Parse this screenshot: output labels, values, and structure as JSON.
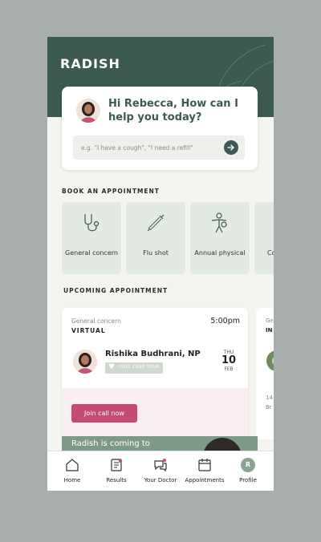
{
  "app": {
    "logo": "RADISH"
  },
  "greeting": {
    "text": "Hi Rebecca, How can I help you today?",
    "search_placeholder": "e.g. \"I have a cough\", \"I need a refill\""
  },
  "booking": {
    "title": "BOOK AN APPOINTMENT",
    "tiles": [
      {
        "label": "General concern",
        "icon": "stethoscope-icon"
      },
      {
        "label": "Flu shot",
        "icon": "syringe-icon"
      },
      {
        "label": "Annual physical",
        "icon": "person-checkup-icon"
      },
      {
        "label": "Co",
        "icon": "partial-tile-icon"
      }
    ]
  },
  "upcoming": {
    "title": "UPCOMING APPOINTMENT",
    "appointment": {
      "type": "General concern",
      "mode": "VIRTUAL",
      "time": "5:00pm",
      "doctor": "Rishika Budhrani, NP",
      "badge": "YOUR CARE TEAM",
      "day": "THU",
      "date": "10",
      "month": "FEB",
      "join_label": "Join call now"
    },
    "next_card": {
      "type": "Ge",
      "mode": "IN",
      "line1": "14",
      "line2": "Br"
    }
  },
  "banner": {
    "text": "Radish is coming to"
  },
  "tabs": [
    {
      "label": "Home",
      "icon": "home-icon"
    },
    {
      "label": "Results",
      "icon": "results-icon"
    },
    {
      "label": "Your Doctor",
      "icon": "chat-doctor-icon"
    },
    {
      "label": "Appointments",
      "icon": "calendar-icon"
    },
    {
      "label": "Profile",
      "icon": "profile-icon",
      "initial": "R"
    }
  ],
  "colors": {
    "brand": "#3c5a52",
    "accent": "#c44c74",
    "tile": "#e3e9e3",
    "background": "#f4f4f1"
  }
}
